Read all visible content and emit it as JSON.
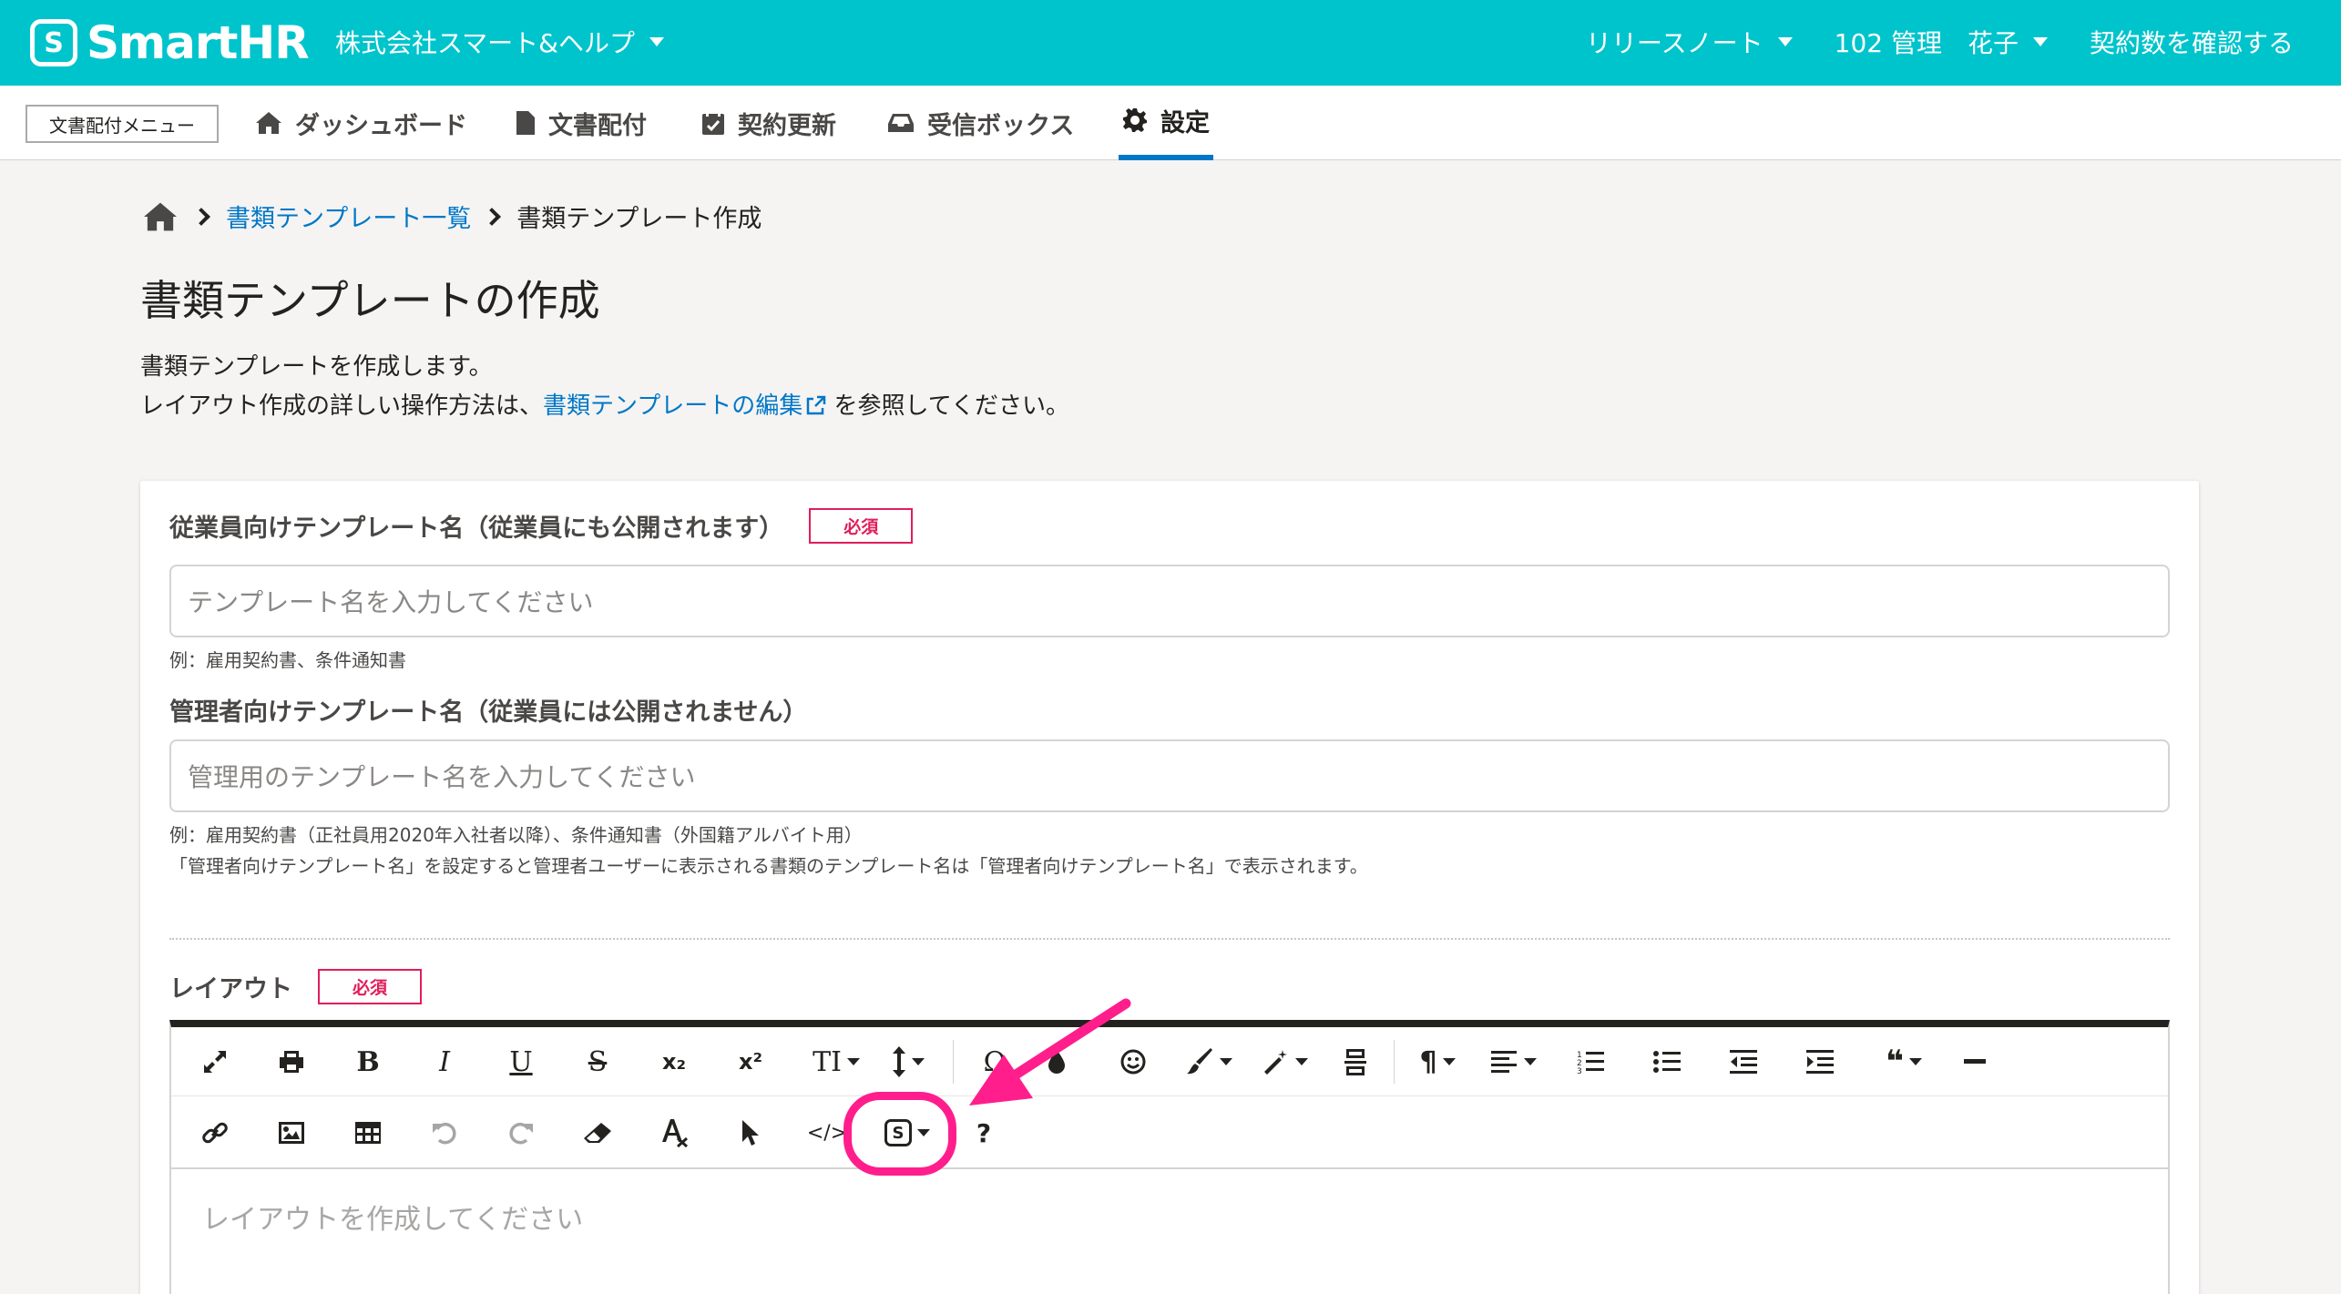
{
  "header": {
    "logo_mark": "S",
    "logo_text": "SmartHR",
    "company": "株式会社スマート&ヘルプ",
    "release_notes": "リリースノート",
    "user": "102 管理　花子",
    "contracts": "契約数を確認する",
    "bg_color": "#00c4cc"
  },
  "subnav": {
    "menu_button": "文書配付メニュー",
    "tabs": [
      {
        "label": "ダッシュボード",
        "icon": "home-icon"
      },
      {
        "label": "文書配付",
        "icon": "file-icon"
      },
      {
        "label": "契約更新",
        "icon": "calendar-icon"
      },
      {
        "label": "受信ボックス",
        "icon": "inbox-icon"
      },
      {
        "label": "設定",
        "icon": "gear-icon",
        "active": true
      }
    ]
  },
  "breadcrumb": {
    "link": "書類テンプレート一覧",
    "current": "書類テンプレート作成"
  },
  "page": {
    "title": "書類テンプレートの作成",
    "desc_line1": "書類テンプレートを作成します。",
    "desc_line2_pre": "レイアウト作成の詳しい操作方法は、",
    "desc_link": "書類テンプレートの編集",
    "desc_line2_post": "を参照してください。"
  },
  "form": {
    "required_label": "必須",
    "employee_name": {
      "label": "従業員向けテンプレート名（従業員にも公開されます）",
      "placeholder": "テンプレート名を入力してください",
      "hint": "例：雇用契約書、条件通知書"
    },
    "admin_name": {
      "label": "管理者向けテンプレート名（従業員には公開されません）",
      "placeholder": "管理用のテンプレート名を入力してください",
      "hint1": "例：雇用契約書（正社員用2020年入社者以降）、条件通知書（外国籍アルバイト用）",
      "hint2": "「管理者向けテンプレート名」を設定すると管理者ユーザーに表示される書類のテンプレート名は「管理者向けテンプレート名」で表示されます。"
    },
    "layout": {
      "label": "レイアウト",
      "placeholder": "レイアウトを作成してください"
    }
  },
  "toolbar": {
    "bold": "B",
    "italic": "I",
    "underline": "U",
    "strike": "S",
    "sub": "x₂",
    "sup": "x²",
    "font_size": "TI",
    "omega": "Ω",
    "para": "¶",
    "quote": "❝",
    "code": "</>",
    "smarthr_var": "S",
    "help": "?"
  },
  "annotation": {
    "color": "#ff1e8c"
  }
}
